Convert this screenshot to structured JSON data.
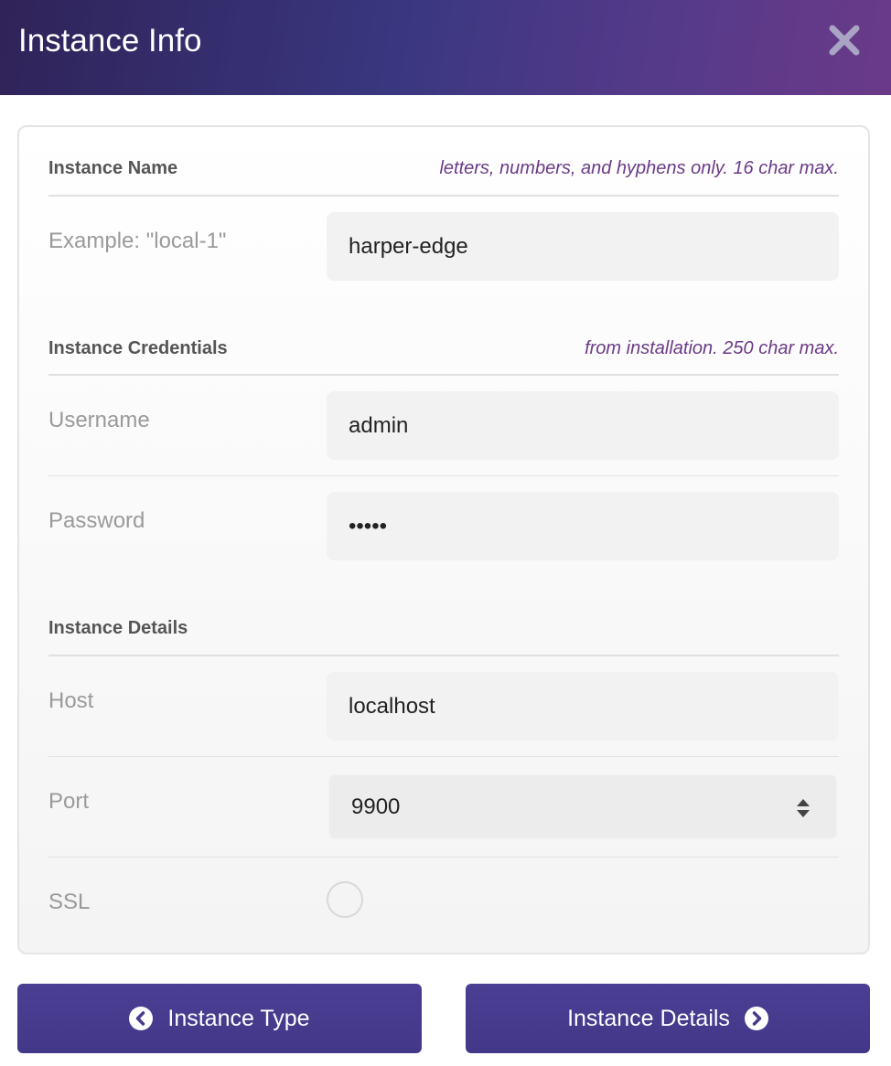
{
  "header": {
    "title": "Instance Info",
    "close_icon": "close-icon"
  },
  "sections": {
    "name": {
      "title": "Instance Name",
      "hint": "letters, numbers, and hyphens only. 16 char max.",
      "label": "Example: \"local-1\"",
      "value": "harper-edge"
    },
    "credentials": {
      "title": "Instance Credentials",
      "hint": "from installation. 250 char max.",
      "username_label": "Username",
      "username_value": "admin",
      "password_label": "Password",
      "password_value": "•••••"
    },
    "details": {
      "title": "Instance Details",
      "host_label": "Host",
      "host_value": "localhost",
      "port_label": "Port",
      "port_value": "9900",
      "ssl_label": "SSL",
      "ssl_checked": false
    }
  },
  "buttons": {
    "back_label": "Instance Type",
    "back_icon": "chevron-left-circle-icon",
    "next_label": "Instance Details",
    "next_icon": "chevron-right-circle-icon"
  },
  "colors": {
    "header_gradient_start": "#2f2358",
    "header_gradient_end": "#6a3a88",
    "hint_text": "#6b3a86",
    "button_bg": "#463b8d"
  }
}
